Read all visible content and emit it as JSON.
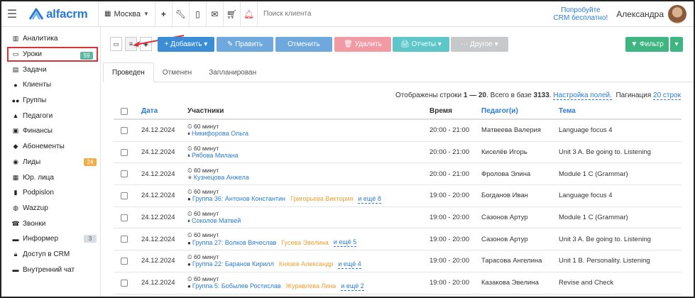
{
  "header": {
    "logo_text": "alfacrm",
    "city": "Москва",
    "search_placeholder": "Поиск клиента",
    "try_free_line1": "Попробуйте",
    "try_free_line2": "CRM бесплатно!",
    "username": "Александра"
  },
  "sidebar": {
    "items": [
      {
        "label": "Аналитика",
        "icon": "chart-icon"
      },
      {
        "label": "Уроки",
        "icon": "calendar-icon",
        "badge": "59"
      },
      {
        "label": "Задачи",
        "icon": "tasks-icon"
      },
      {
        "label": "Клиенты",
        "icon": "user-icon"
      },
      {
        "label": "Группы",
        "icon": "users-icon"
      },
      {
        "label": "Педагоги",
        "icon": "teacher-icon"
      },
      {
        "label": "Финансы",
        "icon": "money-icon"
      },
      {
        "label": "Абонементы",
        "icon": "ticket-icon"
      },
      {
        "label": "Лиды",
        "icon": "funnel-icon",
        "badge": "24"
      },
      {
        "label": "Юр. лица",
        "icon": "building-icon"
      },
      {
        "label": "Podpislon",
        "icon": "doc-icon"
      },
      {
        "label": "Wazzup",
        "icon": "chat-icon"
      },
      {
        "label": "Звонки",
        "icon": "phone-icon"
      },
      {
        "label": "Информер",
        "icon": "info-icon",
        "badge": "3"
      },
      {
        "label": "Доступ в CRM",
        "icon": "lock-icon"
      },
      {
        "label": "Внутренний чат",
        "icon": "message-icon"
      }
    ]
  },
  "toolbar": {
    "add": "+ Добавить ▾",
    "edit": "✎ Править",
    "cancel": "Отменить",
    "delete": "🗑 Удалить",
    "reports": "🖨 Отчеты ▾",
    "other": "··· Другое ▾",
    "filter": "▼ Фильтр",
    "filter_caret": "▾"
  },
  "tabs": [
    "Проведен",
    "Отменен",
    "Запланирован"
  ],
  "info": {
    "prefix": "Отображены строки ",
    "range": "1 — 20",
    "middle": ". Всего в базе ",
    "total": "3133",
    "dot": ".",
    "settings_link": "Настройка полей.",
    "pagination_label": "Пагинация",
    "pagination_link": "20 строк"
  },
  "table": {
    "headers": {
      "date": "Дата",
      "participants": "Участники",
      "time": "Время",
      "teacher": "Педагог(и)",
      "topic": "Тема"
    },
    "rows": [
      {
        "date": "24.12.2024",
        "duration": "60 минут",
        "type": "single",
        "name": "Никифорова Ольга",
        "extra": "",
        "more": "",
        "time": "20:00 - 21:00",
        "teacher": "Матвеева Валерия",
        "topic": "Language focus 4"
      },
      {
        "date": "24.12.2024",
        "duration": "60 минут",
        "type": "single",
        "name": "Рябова Милана",
        "extra": "",
        "more": "",
        "time": "20:00 - 21:00",
        "teacher": "Киселёв Игорь",
        "topic": "Unit 3 A. Be going to. Listening"
      },
      {
        "date": "24.12.2024",
        "duration": "60 минут",
        "type": "trial",
        "name": "Кузнецова Анжела",
        "extra": "",
        "more": "",
        "time": "20:00 - 21:00",
        "teacher": "Фролова Элина",
        "topic": "Module 1 C (Grammar)"
      },
      {
        "date": "24.12.2024",
        "duration": "60 минут",
        "type": "group",
        "name": "Группа 36: Антонов Константин",
        "extra": "Григорьева Виктория",
        "more": "и ещё 8",
        "time": "19:00 - 20:00",
        "teacher": "Богданов Иван",
        "topic": "Language focus 4"
      },
      {
        "date": "24.12.2024",
        "duration": "60 минут",
        "type": "single",
        "name": "Соколов Матвей",
        "extra": "",
        "more": "",
        "time": "19:00 - 20:00",
        "teacher": "Сазонов Артур",
        "topic": "Module 1 C (Grammar)"
      },
      {
        "date": "24.12.2024",
        "duration": "60 минут",
        "type": "group",
        "name": "Группа 27: Волков Вячеслав",
        "extra": "Гусева Эвелина",
        "more": "и ещё 5",
        "time": "19:00 - 20:00",
        "teacher": "Сазонов Артур",
        "topic": "Unit 3 A. Be going to. Listening"
      },
      {
        "date": "24.12.2024",
        "duration": "60 минут",
        "type": "group",
        "name": "Группа 22: Баранов Кирилл",
        "extra": "Князев Александр",
        "more": "и ещё 4",
        "time": "19:00 - 20:00",
        "teacher": "Тарасова Ангелина",
        "topic": "Unit 1 B. Personality. Listening"
      },
      {
        "date": "24.12.2024",
        "duration": "60 минут",
        "type": "group",
        "name": "Группа 5: Бобылев Ростислав",
        "extra": "Журавлева Лина",
        "more": "и ещё 2",
        "time": "19:00 - 20:00",
        "teacher": "Казакова Эвелина",
        "topic": "Revise and Check"
      }
    ]
  },
  "colors": {
    "brand": "#2a7bd6",
    "highlight_border": "#d8333a",
    "green_badge": "#5cb7a3",
    "orange_badge": "#f1ad4a"
  }
}
